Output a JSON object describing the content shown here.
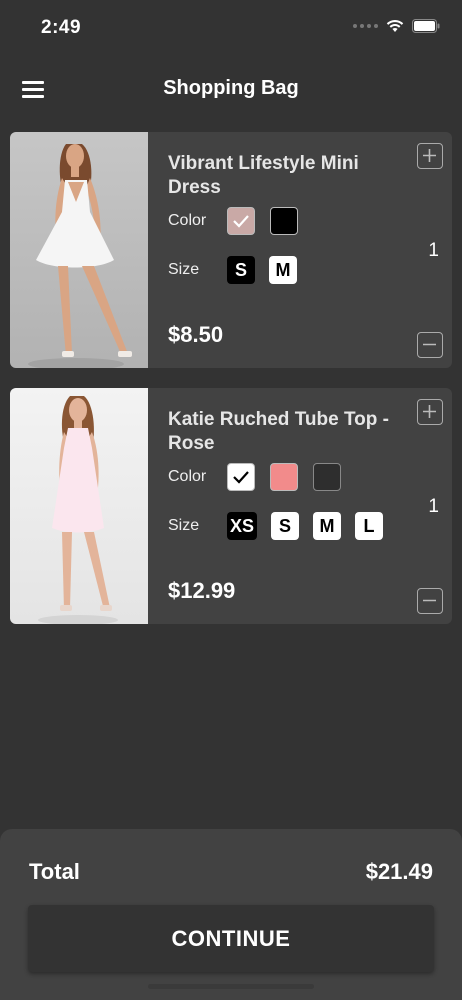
{
  "status_bar": {
    "time": "2:49"
  },
  "header": {
    "title": "Shopping Bag"
  },
  "cart": {
    "items": [
      {
        "name": "Vibrant Lifestyle Mini Dress",
        "color_label": "Color",
        "colors": [
          {
            "hex": "#c9a9a6",
            "selected": true
          },
          {
            "hex": "#000000",
            "selected": false
          }
        ],
        "size_label": "Size",
        "sizes": [
          {
            "label": "S",
            "selected": true
          },
          {
            "label": "M",
            "selected": false
          }
        ],
        "price": "$8.50",
        "quantity": "1",
        "image_icon": "dress-photo"
      },
      {
        "name": "Katie Ruched Tube Top - Rose",
        "color_label": "Color",
        "colors": [
          {
            "hex": "#ffffff",
            "selected": true
          },
          {
            "hex": "#f28b8b",
            "selected": false
          },
          {
            "hex": "#2e2e2e",
            "selected": false
          }
        ],
        "size_label": "Size",
        "sizes": [
          {
            "label": "XS",
            "selected": true
          },
          {
            "label": "S",
            "selected": false
          },
          {
            "label": "M",
            "selected": false
          },
          {
            "label": "L",
            "selected": false
          }
        ],
        "price": "$12.99",
        "quantity": "1",
        "image_icon": "dress-photo"
      }
    ]
  },
  "footer": {
    "total_label": "Total",
    "total_value": "$21.49",
    "continue_label": "CONTINUE"
  },
  "colors": {
    "background": "#333333",
    "card": "#424242",
    "text": "#ffffff"
  }
}
